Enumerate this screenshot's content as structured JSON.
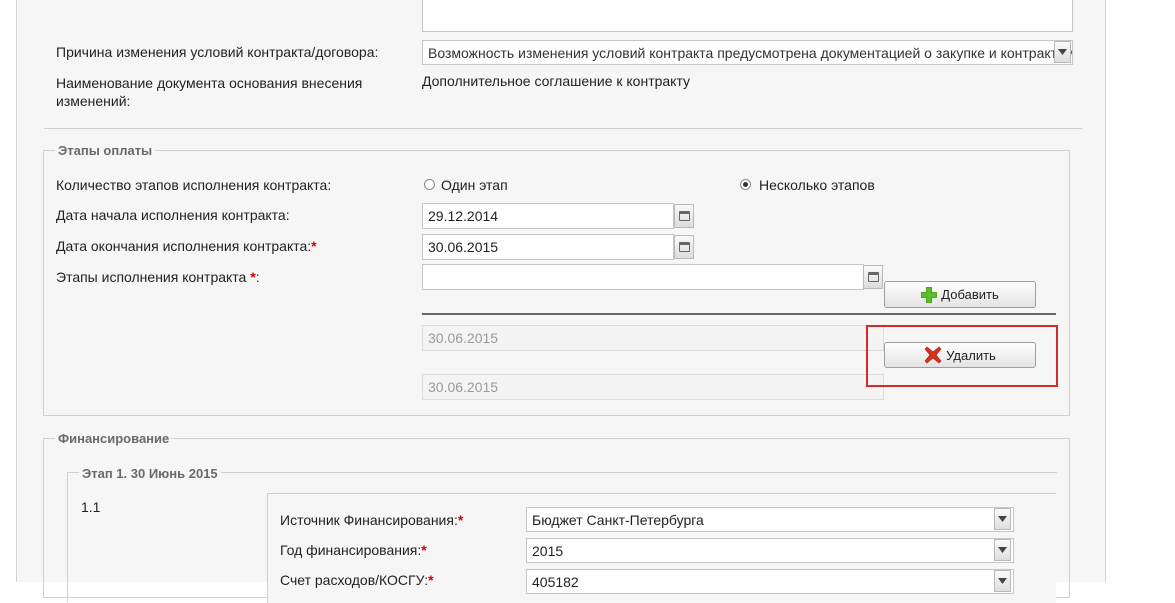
{
  "contract_change": {
    "reason_label": "Причина изменения условий контракта/договора:",
    "reason_value": "Возможность изменения условий контракта предусмотрена документацией о закупке и контрактом",
    "doc_name_label": "Наименование документа основания внесения изменений:",
    "doc_name_value": "Дополнительное соглашение к контракту"
  },
  "payment_stages": {
    "legend": "Этапы оплаты",
    "stage_count_label": "Количество этапов исполнения контракта:",
    "option_one": "Один этап",
    "option_many": "Несколько этапов",
    "selected": "Несколько этапов",
    "start_date_label": "Дата начала исполнения контракта:",
    "start_date_value": "29.12.2014",
    "end_date_label": "Дата окончания исполнения контракта:",
    "end_date_value": "30.06.2015",
    "stages_label": "Этапы исполнения контракта",
    "stages_input_value": "",
    "add_button": "Добавить",
    "delete_button": "Удалить",
    "stage_rows": [
      "30.06.2015",
      "30.06.2015"
    ],
    "required_mark": "*"
  },
  "financing": {
    "legend": "Финансирование",
    "stage_legend": "Этап 1. 30 Июнь 2015",
    "row_number": "1.1",
    "source_label": "Источник Финансирования:",
    "source_value": "Бюджет Санкт-Петербурга",
    "year_label": "Год финансирования:",
    "year_value": "2015",
    "account_label": "Счет расходов/КОСГУ:",
    "account_value": "405182"
  },
  "colors": {
    "highlight": "#d42a2a",
    "required": "#d60000",
    "add_icon": "#5bbf2a",
    "delete_icon": "#d8321e"
  },
  "icons": {
    "dropdown": "chevron-down-icon",
    "calendar": "calendar-icon",
    "add": "plus-icon",
    "delete": "x-icon"
  }
}
